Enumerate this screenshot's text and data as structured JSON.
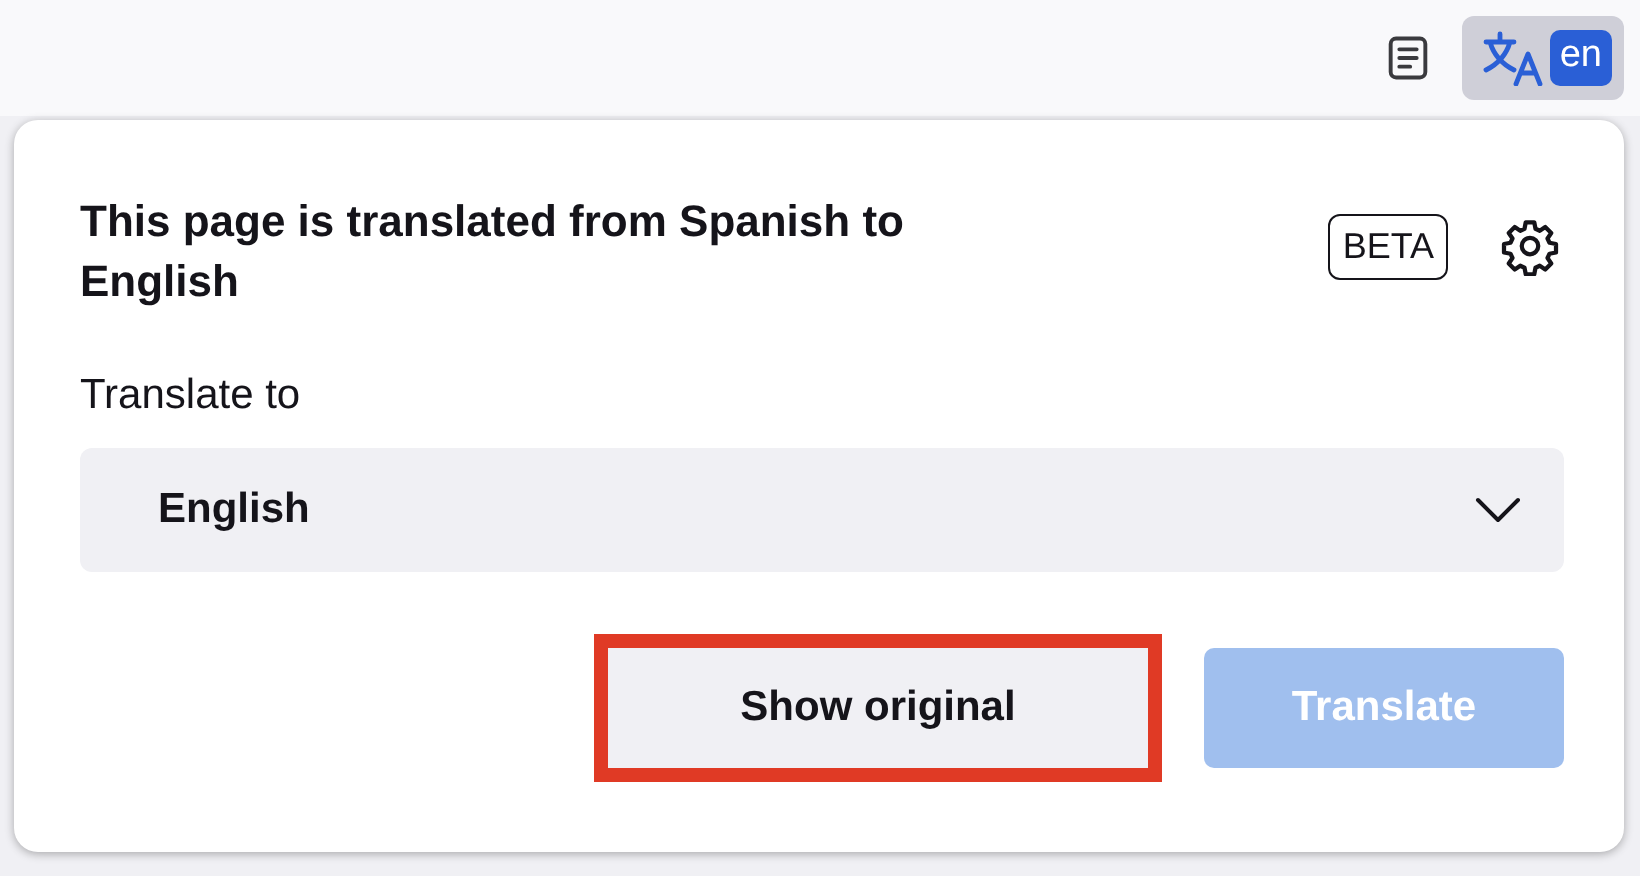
{
  "toolbar": {
    "language_badge": "en",
    "translate_button_active": true
  },
  "popup": {
    "title": "This page is translated from Spanish to English",
    "badge": "BETA",
    "field_label": "Translate to",
    "language_select": {
      "value": "English"
    },
    "buttons": [
      {
        "label": "Show original",
        "kind": "secondary",
        "disabled": false,
        "highlighted": true
      },
      {
        "label": "Translate",
        "kind": "primary",
        "disabled": true,
        "highlighted": false
      }
    ]
  }
}
